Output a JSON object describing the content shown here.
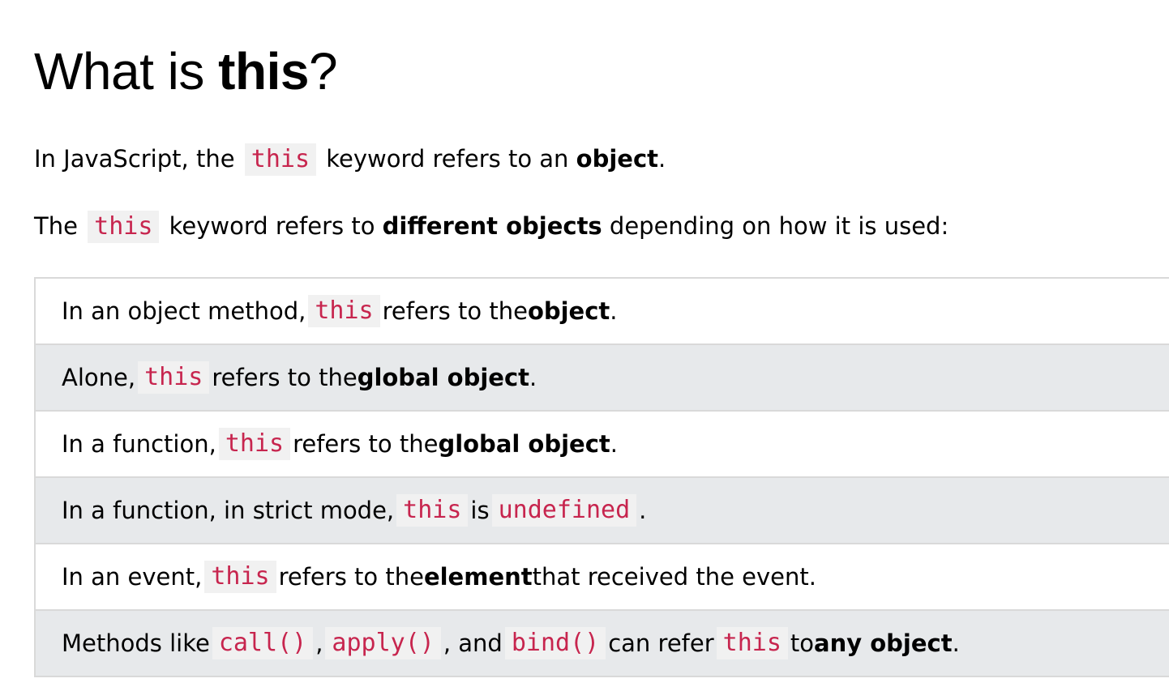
{
  "heading": {
    "prefix": "What is ",
    "keyword": "this",
    "suffix": "?"
  },
  "paragraph1": {
    "t1": "In JavaScript, the ",
    "code": "this",
    "t2": " keyword refers to an ",
    "bold": "object",
    "t3": "."
  },
  "paragraph2": {
    "t1": "The ",
    "code": "this",
    "t2": " keyword refers to ",
    "bold": "different objects",
    "t3": " depending on how it is used:"
  },
  "rows": [
    {
      "t1": "In an object method, ",
      "code": "this",
      "t2": " refers to the ",
      "bold": "object",
      "t3": "."
    },
    {
      "t1": "Alone, ",
      "code": "this",
      "t2": " refers to the ",
      "bold": "global object",
      "t3": "."
    },
    {
      "t1": "In a function, ",
      "code": "this",
      "t2": " refers to the ",
      "bold": "global object",
      "t3": "."
    },
    {
      "t1": "In a function, in strict mode, ",
      "code": "this",
      "t2": " is ",
      "code2": "undefined",
      "t3": "."
    },
    {
      "t1": "In an event, ",
      "code": "this",
      "t2": " refers to the ",
      "bold": "element",
      "t3": " that received the event."
    },
    {
      "t1": "Methods like ",
      "code": "call()",
      "t2": ", ",
      "code2": "apply()",
      "t3": ", and ",
      "code3": "bind()",
      "t4": " can refer ",
      "code4": "this",
      "t5": " to ",
      "bold": "any object",
      "t6": "."
    }
  ],
  "colors": {
    "code_text": "#c7254e",
    "code_bg": "#f1f1f1",
    "alt_row_bg": "#e7e9eb",
    "border": "#d9d9d9"
  }
}
